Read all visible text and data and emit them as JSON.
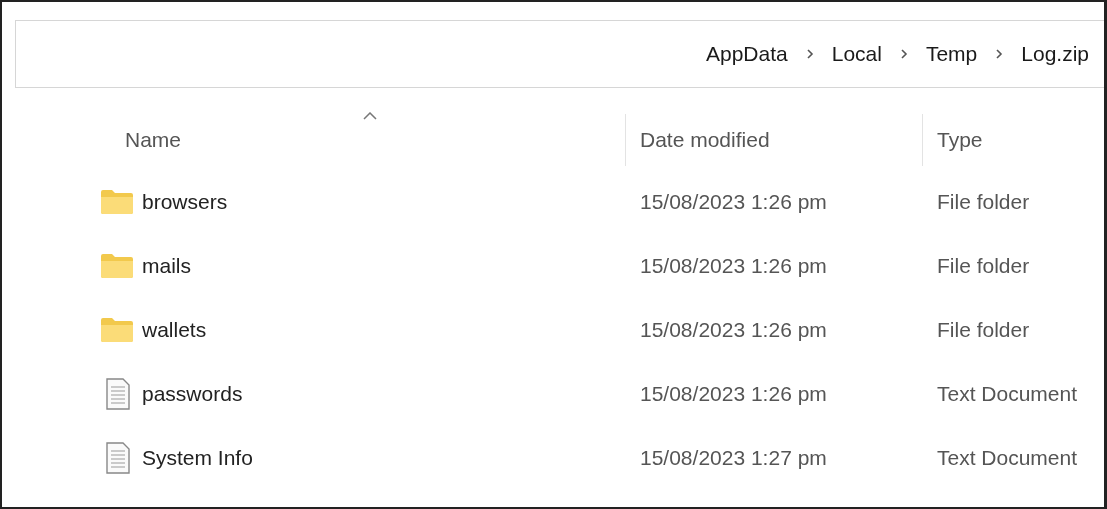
{
  "address_bar": {
    "breadcrumb": [
      "AppData",
      "Local",
      "Temp",
      "Log.zip"
    ]
  },
  "columns": [
    {
      "label": "Name",
      "sorted": true
    },
    {
      "label": "Date modified",
      "sorted": false
    },
    {
      "label": "Type",
      "sorted": false
    }
  ],
  "rows": [
    {
      "kind": "folder",
      "name": "browsers",
      "date_modified": "15/08/2023 1:26 pm",
      "type": "File folder"
    },
    {
      "kind": "folder",
      "name": "mails",
      "date_modified": "15/08/2023 1:26 pm",
      "type": "File folder"
    },
    {
      "kind": "folder",
      "name": "wallets",
      "date_modified": "15/08/2023 1:26 pm",
      "type": "File folder"
    },
    {
      "kind": "document",
      "name": "passwords",
      "date_modified": "15/08/2023 1:26 pm",
      "type": "Text Document"
    },
    {
      "kind": "document",
      "name": "System Info",
      "date_modified": "15/08/2023 1:27 pm",
      "type": "Text Document"
    }
  ]
}
